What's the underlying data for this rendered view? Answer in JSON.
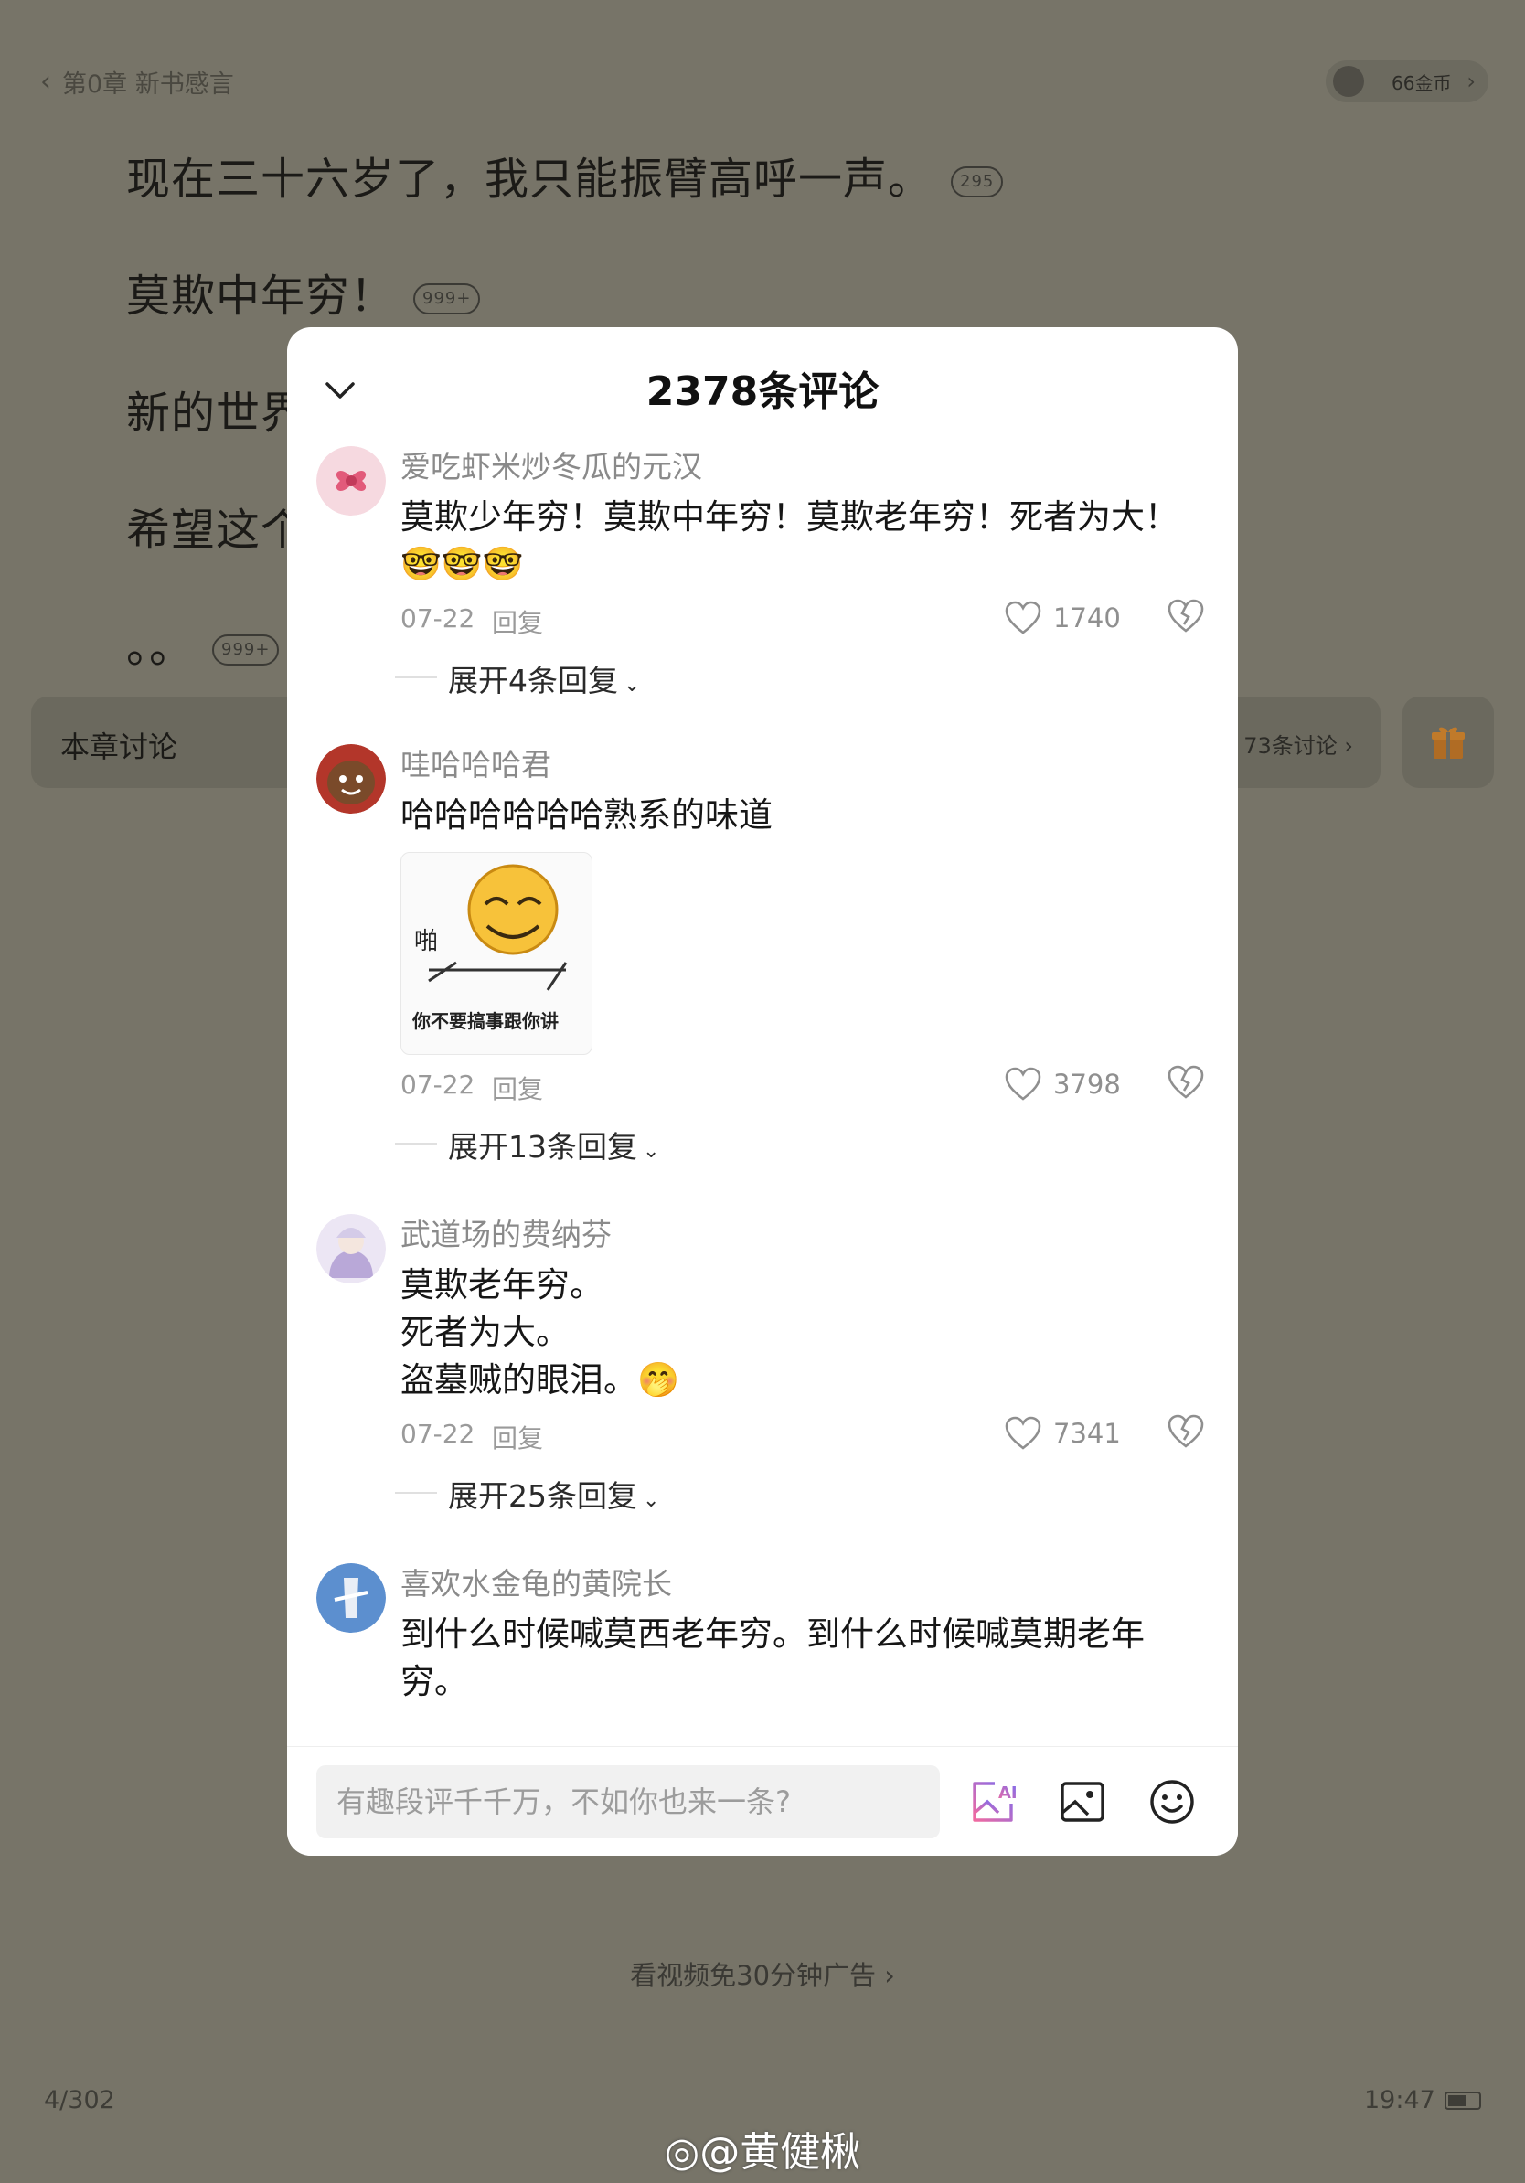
{
  "reader": {
    "chapter_title": "第0章 新书感言",
    "coins": "66金币",
    "paragraphs": [
      {
        "text": "现在三十六岁了，我只能振臂高呼一声。",
        "badge": "295"
      },
      {
        "text": "莫欺中年穷！",
        "badge": "999+"
      },
      {
        "text": "新的世界",
        "badge": ""
      },
      {
        "text": "希望这个",
        "badge": ""
      },
      {
        "text": "。。",
        "badge": "999+"
      }
    ],
    "discussion_label": "本章讨论",
    "discussion_count": "73条讨论 ›",
    "ad_text": "看视频免30分钟广告",
    "page_indicator": "4/302",
    "clock": "19:47",
    "watermark": "@黄健楸"
  },
  "modal": {
    "title": "2378条评论",
    "comments": [
      {
        "username": "爱吃虾米炒冬瓜的元汉",
        "text": "莫欺少年穷！莫欺中年穷！莫欺老年穷！死者为大！",
        "emojis": "🤓🤓🤓",
        "date": "07-22",
        "reply_label": "回复",
        "likes": "1740",
        "expand_label": "展开4条回复"
      },
      {
        "username": "哇哈哈哈君",
        "text": "哈哈哈哈哈哈熟系的味道",
        "meme_text": "你不要搞事跟你讲",
        "meme_side": "啪",
        "date": "07-22",
        "reply_label": "回复",
        "likes": "3798",
        "expand_label": "展开13条回复"
      },
      {
        "username": "武道场的费纳芬",
        "text": "莫欺老年穷。\n死者为大。\n盗墓贼的眼泪。🤭",
        "date": "07-22",
        "reply_label": "回复",
        "likes": "7341",
        "expand_label": "展开25条回复"
      },
      {
        "username": "喜欢水金龟的黄院长",
        "text": "到什么时候喊莫西老年穷。到什么时候喊莫期老年\n穷。"
      }
    ],
    "input_placeholder": "有趣段评千千万，不如你也来一条?"
  },
  "colors": {
    "overlay_bg": "#777468",
    "modal_bg": "#ffffff",
    "accent_gift": "#c07a2a",
    "ai_gradient_start": "#f06aa0",
    "ai_gradient_end": "#7a6cf0"
  },
  "icons": [
    "back-chevron-icon",
    "coin-icon",
    "comment-bubble-icon",
    "gift-icon",
    "collapse-chevron-icon",
    "heart-icon",
    "broken-heart-icon",
    "ai-image-icon",
    "image-icon",
    "emoji-icon",
    "battery-icon",
    "weibo-icon"
  ]
}
